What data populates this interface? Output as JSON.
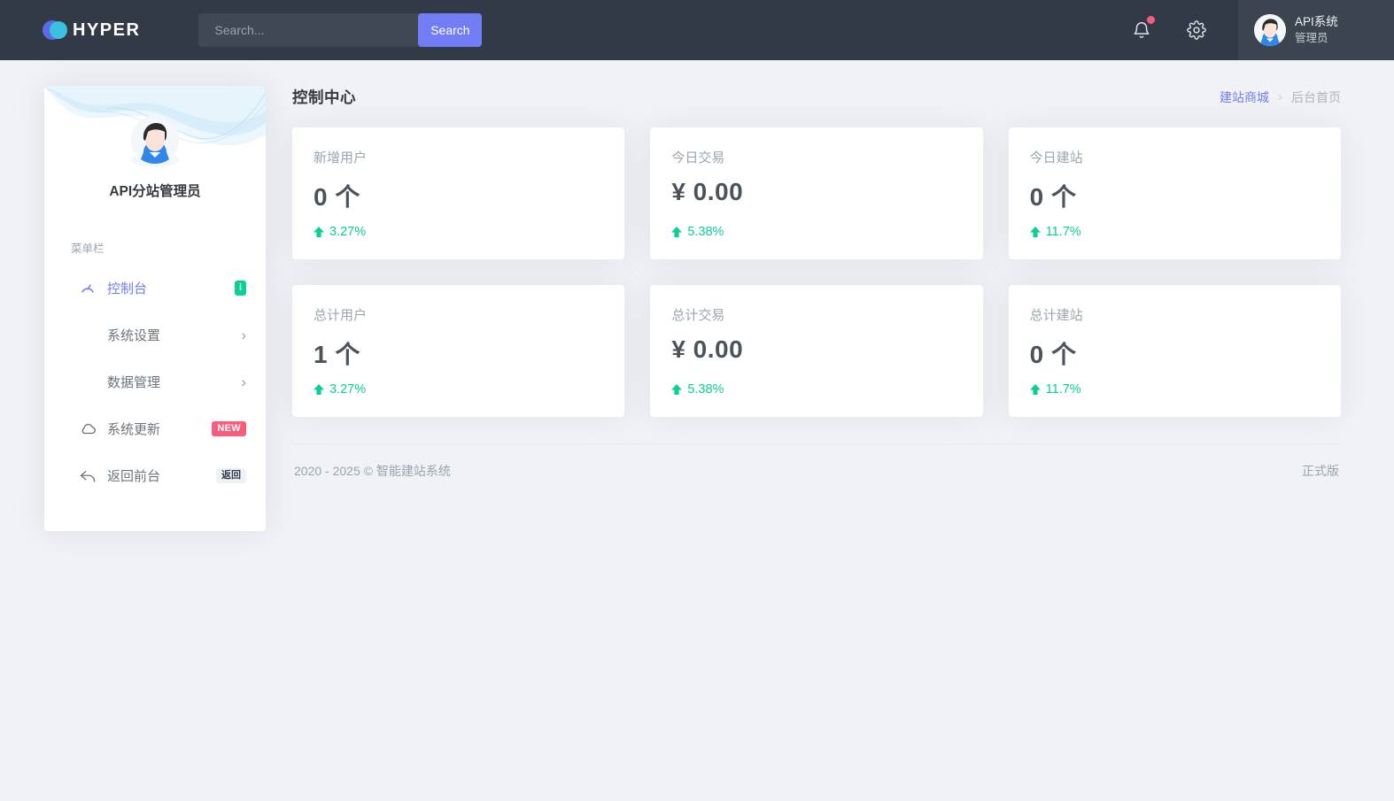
{
  "navbar": {
    "brand": "HYPER",
    "search": {
      "placeholder": "Search...",
      "button_label": "Search"
    },
    "user": {
      "title": "API系统",
      "subtitle": "管理员"
    }
  },
  "sidebar": {
    "profile_name": "API分站管理员",
    "section_label": "菜单栏",
    "menu": [
      {
        "label": "控制台",
        "icon": "dashboard-icon",
        "badge": "i",
        "active": true
      },
      {
        "label": "系统设置",
        "icon": "grid-icon",
        "expand": "›"
      },
      {
        "label": "数据管理",
        "icon": "grid-icon",
        "expand": "›"
      },
      {
        "label": "系统更新",
        "icon": "cloud-icon",
        "badge": "NEW"
      },
      {
        "label": "返回前台",
        "icon": "reply-icon",
        "badge": "返回"
      }
    ]
  },
  "page": {
    "title": "控制中心",
    "breadcrumb": {
      "parent": "建站商城",
      "separator": "›",
      "current": "后台首页"
    }
  },
  "cards": [
    {
      "label": "新增用户",
      "value": "0 个",
      "delta": "3.27%",
      "trend": "up"
    },
    {
      "label": "今日交易",
      "value": "¥ 0.00",
      "delta": "5.38%",
      "trend": "up"
    },
    {
      "label": "今日建站",
      "value": "0 个",
      "delta": "11.7%",
      "trend": "up"
    },
    {
      "label": "总计用户",
      "value": "1 个",
      "delta": "3.27%",
      "trend": "up"
    },
    {
      "label": "总计交易",
      "value": "¥ 0.00",
      "delta": "5.38%",
      "trend": "up"
    },
    {
      "label": "总计建站",
      "value": "0 个",
      "delta": "11.7%",
      "trend": "up"
    }
  ],
  "footer": {
    "copyright": "2020 - 2025 © 智能建站系统",
    "version": "正式版"
  },
  "colors": {
    "primary": "#727cf5",
    "success": "#0acf97",
    "danger": "#fa5c7c",
    "navbar_bg": "#313a46",
    "cyan": "#39afd1",
    "page_bg": "#f0f2f6"
  }
}
